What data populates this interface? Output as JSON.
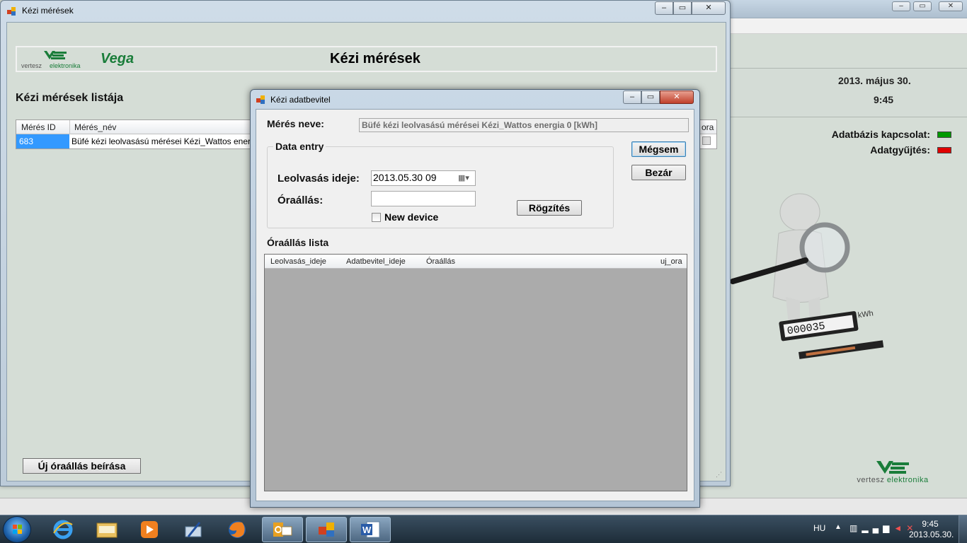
{
  "background_app": {
    "date": "2013. május 30.",
    "time": "9:45",
    "db_connection_label": "Adatbázis kapcsolat:",
    "data_collection_label": "Adatgyűjtés:",
    "db_connection_color": "#009900",
    "data_collection_color": "#e00000",
    "logo_text_1": "vertesz",
    "logo_text_2": "elektronika",
    "meter_unit": "kWh",
    "meter_digits": "000035"
  },
  "main_window": {
    "title": "Kézi mérések",
    "header": {
      "logo_text_1": "vertesz",
      "logo_text_2": "elektronika",
      "brand": "Vega",
      "title": "Kézi mérések"
    },
    "list_title": "Kézi mérések listája",
    "grid": {
      "columns": [
        "Mérés ID",
        "Mérés_név",
        "ora"
      ],
      "rows": [
        {
          "id": "683",
          "name": "Büfé kézi leolvasású mérései Kézi_Wattos energia 0 [k"
        }
      ]
    },
    "new_button": "Új óraállás beírása"
  },
  "dialog": {
    "title": "Kézi adatbevitel",
    "meres_neve_label": "Mérés neve:",
    "meres_neve_value": "Büfé kézi leolvasású mérései Kézi_Wattos energia 0 [kWh]",
    "group_title": "Data entry",
    "leolvasas_label": "Leolvasás ideje:",
    "leolvasas_value": "2013.05.30 09",
    "oraallas_label": "Óraállás:",
    "oraallas_value": "",
    "new_device_label": "New device",
    "new_device_checked": false,
    "rogzites_button": "Rögzítés",
    "megsem_button": "Mégsem",
    "bezar_button": "Bezár",
    "list_title": "Óraállás lista",
    "list_columns": [
      "Leolvasás_ideje",
      "Adatbevitel_ideje",
      "Óraállás",
      "uj_ora"
    ]
  },
  "taskbar": {
    "language": "HU",
    "time": "9:45",
    "date": "2013.05.30."
  }
}
